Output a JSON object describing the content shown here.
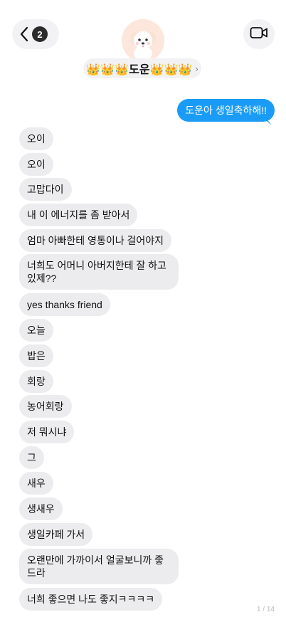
{
  "header": {
    "back_badge_count": "2",
    "contact_name": "👑👑👑도운👑👑👑",
    "chevron": "›",
    "icons": {
      "back": "chevron-left-icon",
      "video": "video-camera-icon",
      "avatar": "puppy-avatar"
    }
  },
  "messages": {
    "sent": [
      {
        "text": "도운아 생일축하해!!"
      }
    ],
    "received": [
      {
        "text": "오이"
      },
      {
        "text": "오이"
      },
      {
        "text": "고맙다이"
      },
      {
        "text": "내 이 에너지를 좀 받아서"
      },
      {
        "text": "엄마 아빠한테 영통이나 걸어야지"
      },
      {
        "text": "너희도 어머니 아버지한테 잘 하고 있제??"
      },
      {
        "text": "yes thanks friend"
      },
      {
        "text": "오늘"
      },
      {
        "text": "밥은"
      },
      {
        "text": "회랑"
      },
      {
        "text": "농어회랑"
      },
      {
        "text": "저 뭐시냐"
      },
      {
        "text": "그"
      },
      {
        "text": "새우"
      },
      {
        "text": "생새우"
      },
      {
        "text": "생일카페 가서"
      },
      {
        "text": "오랜만에 가까이서 얼굴보니까 좋드라"
      },
      {
        "text": "너희 좋으면 나도 좋지ㅋㅋㅋㅋ"
      }
    ]
  },
  "page_indicator": "1 / 14",
  "colors": {
    "sent_bubble": "#1a9cf6",
    "received_bubble": "#ececee",
    "pill_background": "#f2f2f4"
  }
}
